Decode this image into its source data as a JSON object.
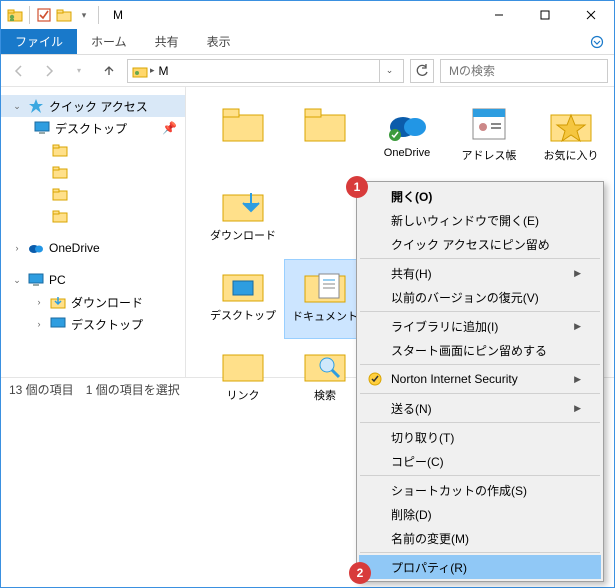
{
  "titlebar": {
    "title": "M"
  },
  "ribbon": {
    "file": "ファイル",
    "home": "ホーム",
    "share": "共有",
    "view": "表示"
  },
  "addr": {
    "folder": "M",
    "search_placeholder": "Mの検索"
  },
  "sidebar": {
    "quick_access": "クイック アクセス",
    "desktop": "デスクトップ",
    "onedrive": "OneDrive",
    "pc": "PC",
    "downloads": "ダウンロード",
    "desktop2": "デスクトップ"
  },
  "content": {
    "row1": [
      "",
      "",
      "OneDrive",
      "アドレス帳",
      "お気に入り",
      "ダウンロード"
    ],
    "row2": [
      "デスクトップ",
      "ドキュメント"
    ],
    "row3": [
      "リンク",
      "検索"
    ]
  },
  "statusbar": {
    "count": "13 個の項目",
    "selected": "1 個の項目を選択"
  },
  "menu": {
    "open": "開く(O)",
    "open_new": "新しいウィンドウで開く(E)",
    "pin_quick": "クイック アクセスにピン留め",
    "share": "共有(H)",
    "prev_versions": "以前のバージョンの復元(V)",
    "include_library": "ライブラリに追加(I)",
    "pin_start": "スタート画面にピン留めする",
    "norton": "Norton Internet Security",
    "send_to": "送る(N)",
    "cut": "切り取り(T)",
    "copy": "コピー(C)",
    "shortcut": "ショートカットの作成(S)",
    "delete": "削除(D)",
    "rename": "名前の変更(M)",
    "properties": "プロパティ(R)"
  },
  "badges": {
    "one": "1",
    "two": "2"
  }
}
